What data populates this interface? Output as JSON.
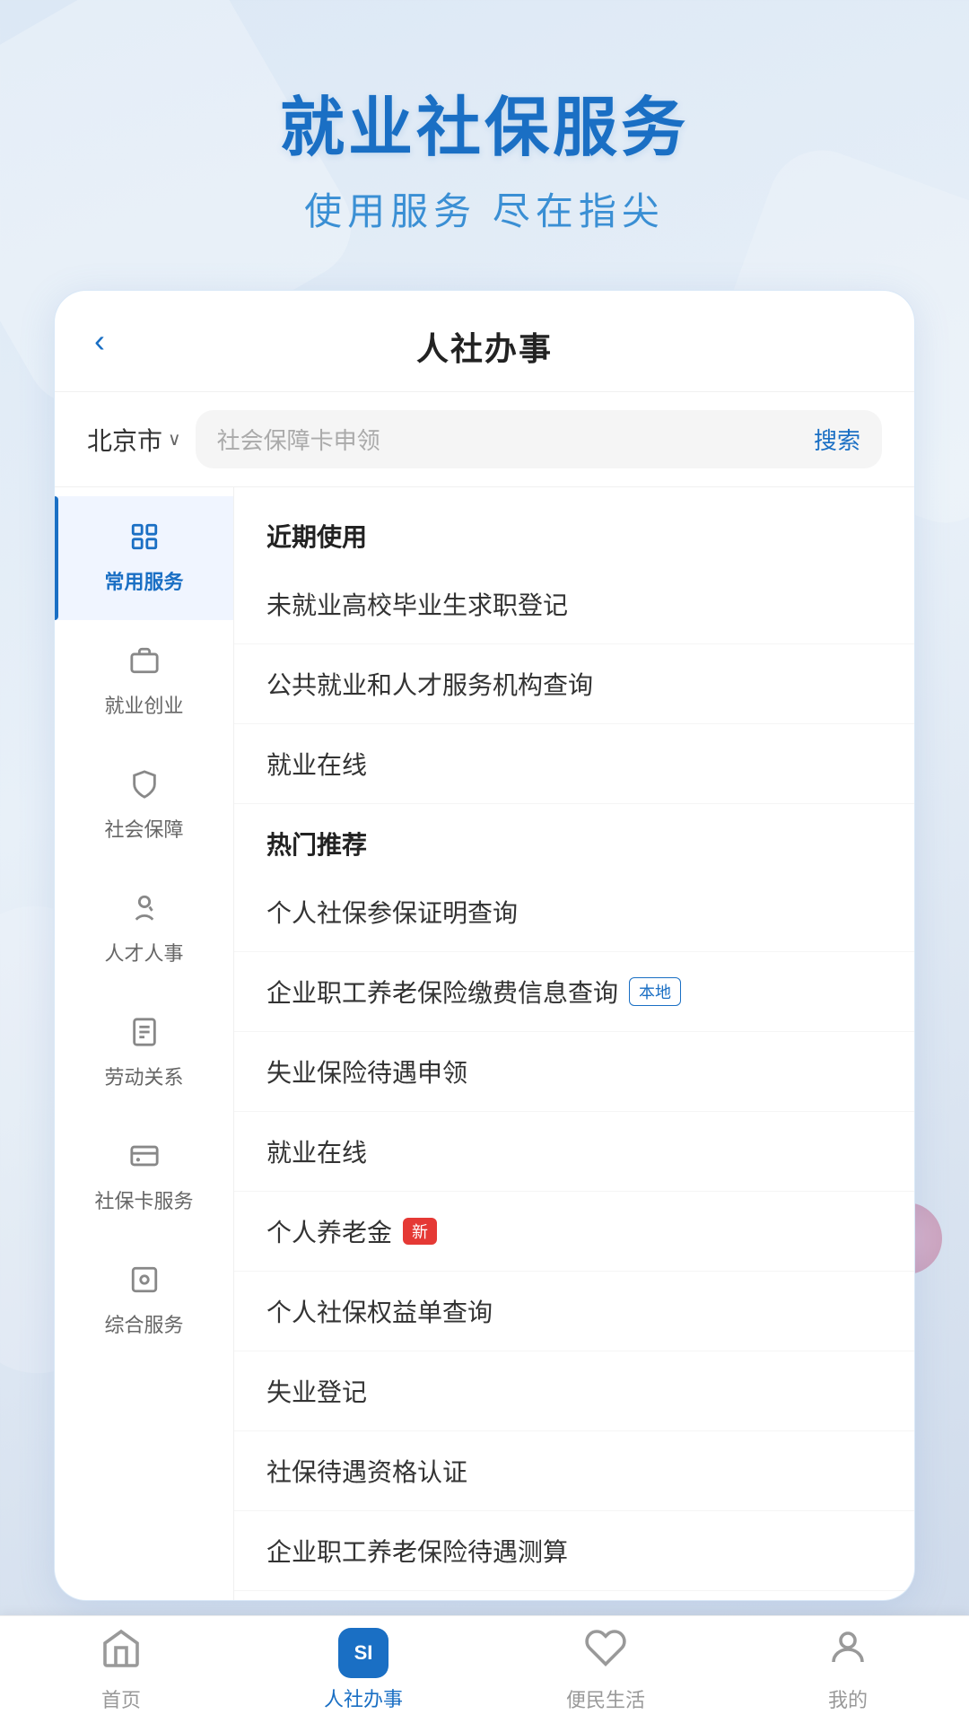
{
  "hero": {
    "title": "就业社保服务",
    "subtitle": "使用服务 尽在指尖"
  },
  "card": {
    "back_label": "‹",
    "title": "人社办事"
  },
  "search": {
    "city": "北京市",
    "placeholder": "社会保障卡申领",
    "button": "搜索"
  },
  "sidebar": {
    "items": [
      {
        "label": "常用服务",
        "active": true,
        "icon": "grid"
      },
      {
        "label": "就业创业",
        "active": false,
        "icon": "briefcase"
      },
      {
        "label": "社会保障",
        "active": false,
        "icon": "shield"
      },
      {
        "label": "人才人事",
        "active": false,
        "icon": "person"
      },
      {
        "label": "劳动关系",
        "active": false,
        "icon": "document"
      },
      {
        "label": "社保卡服务",
        "active": false,
        "icon": "card"
      },
      {
        "label": "综合服务",
        "active": false,
        "icon": "grid2"
      }
    ]
  },
  "content": {
    "sections": [
      {
        "header": "近期使用",
        "items": [
          {
            "text": "未就业高校毕业生求职登记",
            "badge": null
          },
          {
            "text": "公共就业和人才服务机构查询",
            "badge": null
          },
          {
            "text": "就业在线",
            "badge": null
          }
        ]
      },
      {
        "header": "热门推荐",
        "items": [
          {
            "text": "个人社保参保证明查询",
            "badge": null
          },
          {
            "text": "企业职工养老保险缴费信息查询",
            "badge": "local"
          },
          {
            "text": "失业保险待遇申领",
            "badge": null
          },
          {
            "text": "就业在线",
            "badge": null
          },
          {
            "text": "个人养老金",
            "badge": "new"
          },
          {
            "text": "个人社保权益单查询",
            "badge": null
          },
          {
            "text": "失业登记",
            "badge": null
          },
          {
            "text": "社保待遇资格认证",
            "badge": null
          },
          {
            "text": "企业职工养老保险待遇测算",
            "badge": null
          }
        ]
      }
    ],
    "badge_local_text": "本地",
    "badge_new_text": "新"
  },
  "bottom_nav": {
    "items": [
      {
        "label": "首页",
        "active": false,
        "icon": "home"
      },
      {
        "label": "人社办事",
        "active": true,
        "icon": "si"
      },
      {
        "label": "便民生活",
        "active": false,
        "icon": "heart"
      },
      {
        "label": "我的",
        "active": false,
        "icon": "person"
      }
    ]
  }
}
